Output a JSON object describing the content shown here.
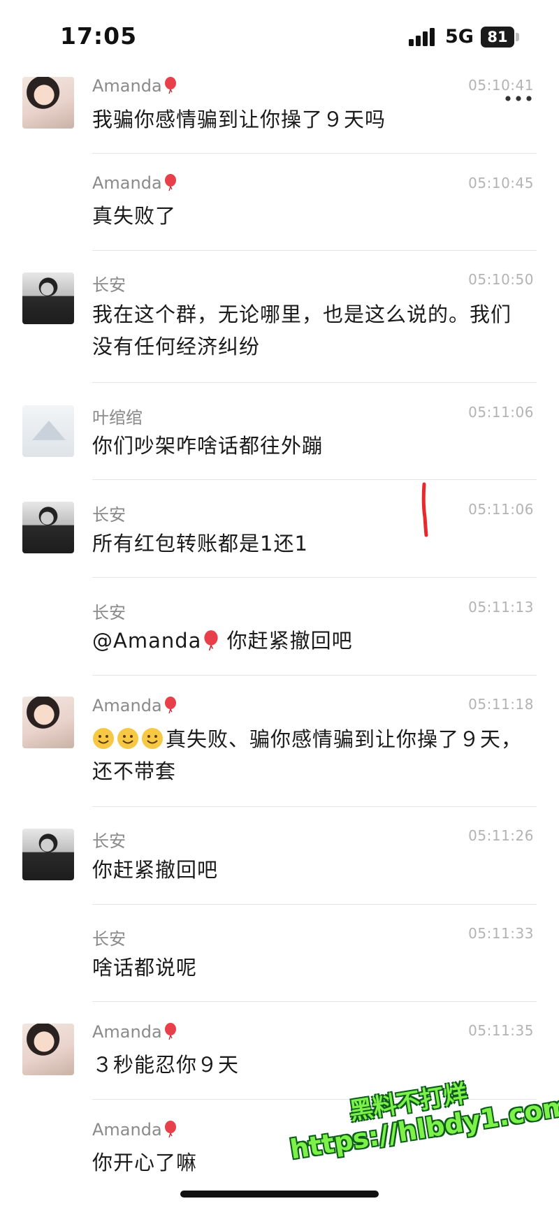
{
  "status_bar": {
    "time": "17:05",
    "network": "5G",
    "battery_level": "81"
  },
  "messages": [
    {
      "sender": "Amanda",
      "time": "05:10:41",
      "text": "我骗你感情骗到让你操了９天吗"
    },
    {
      "sender": "Amanda",
      "time": "05:10:45",
      "text": "真失败了"
    },
    {
      "sender": "长安",
      "time": "05:10:50",
      "text": "我在这个群，无论哪里，也是这么说的。我们没有任何经济纠纷"
    },
    {
      "sender": "叶绾绾",
      "time": "05:11:06",
      "text": "你们吵架咋啥话都往外蹦"
    },
    {
      "sender": "长安",
      "time": "05:11:06",
      "text": "所有红包转账都是1还1"
    },
    {
      "sender": "长安",
      "time": "05:11:13",
      "text_pre": "@Amanda",
      "text_post": " 你赶紧撤回吧"
    },
    {
      "sender": "Amanda",
      "time": "05:11:18",
      "text": "真失败、骗你感情骗到让你操了９天，还不带套"
    },
    {
      "sender": "长安",
      "time": "05:11:26",
      "text": "你赶紧撤回吧"
    },
    {
      "sender": "长安",
      "time": "05:11:33",
      "text": "啥话都说呢"
    },
    {
      "sender": "Amanda",
      "time": "05:11:35",
      "text": "３秒能忍你９天"
    },
    {
      "sender": "Amanda",
      "time": "",
      "text": "你开心了嘛"
    }
  ],
  "watermark": {
    "line1": "黑料不打烊",
    "line2": "https://hlbdy1.com"
  },
  "colors": {
    "name_gray": "#8a8a8a",
    "time_gray": "#b3b3b3",
    "divider": "#e5e5e5",
    "watermark_green": "#7df04a"
  },
  "icons": [
    "signal-icon",
    "battery-icon",
    "more-icon",
    "balloon-icon",
    "smile-emoji-icon"
  ]
}
